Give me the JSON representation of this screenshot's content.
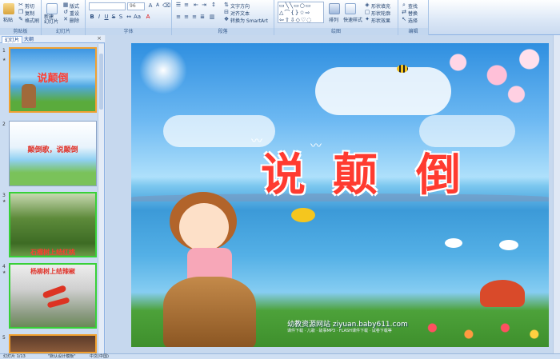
{
  "ribbon": {
    "clipboard": {
      "label": "剪贴板",
      "paste": "粘贴",
      "cut": "剪切",
      "copy": "复制",
      "format_painter": "格式刷"
    },
    "slides": {
      "label": "幻灯片",
      "new_slide": "新建\n幻灯片",
      "layout": "版式",
      "reset": "重设",
      "delete": "删除"
    },
    "font": {
      "label": "字体",
      "font_size": "96"
    },
    "paragraph": {
      "label": "段落",
      "text_direction": "文字方向",
      "align_text": "对齐文本",
      "smartart": "转换为 SmartArt"
    },
    "drawing": {
      "label": "绘图",
      "arrange": "排列",
      "quick_styles": "快速样式",
      "shape_fill": "形状填充",
      "shape_outline": "形状轮廓",
      "shape_effects": "形状效果"
    },
    "editing": {
      "label": "编辑",
      "find": "查找",
      "replace": "替换",
      "select": "选择"
    }
  },
  "pane": {
    "tabs": [
      "幻灯片",
      "大纲"
    ],
    "close": "×",
    "thumbnails": [
      {
        "num": "1",
        "title": "说颠倒"
      },
      {
        "num": "2",
        "title": "颠倒歌，说颠倒"
      },
      {
        "num": "3",
        "title": "石榴树上结红桃"
      },
      {
        "num": "4",
        "title": "杨柳树上结辣椒"
      },
      {
        "num": "5",
        "title": ""
      }
    ]
  },
  "slide": {
    "title_chars": [
      "说",
      "颠",
      "倒"
    ],
    "site_name": "幼教资源网站 ziyuan.baby611.com",
    "site_sub": "课件下载 · 儿歌 · 故事MP3 · FLASH课件下载 · 试卷下载等"
  },
  "status": {
    "slide_count": "幻灯片 1/13",
    "theme": "\"默认设计模板\"",
    "language": "中文(中国)"
  },
  "colors": {
    "title_red": "#ff3b30",
    "thumb_selected": "#f0a030",
    "thumb_green": "#38d038"
  }
}
